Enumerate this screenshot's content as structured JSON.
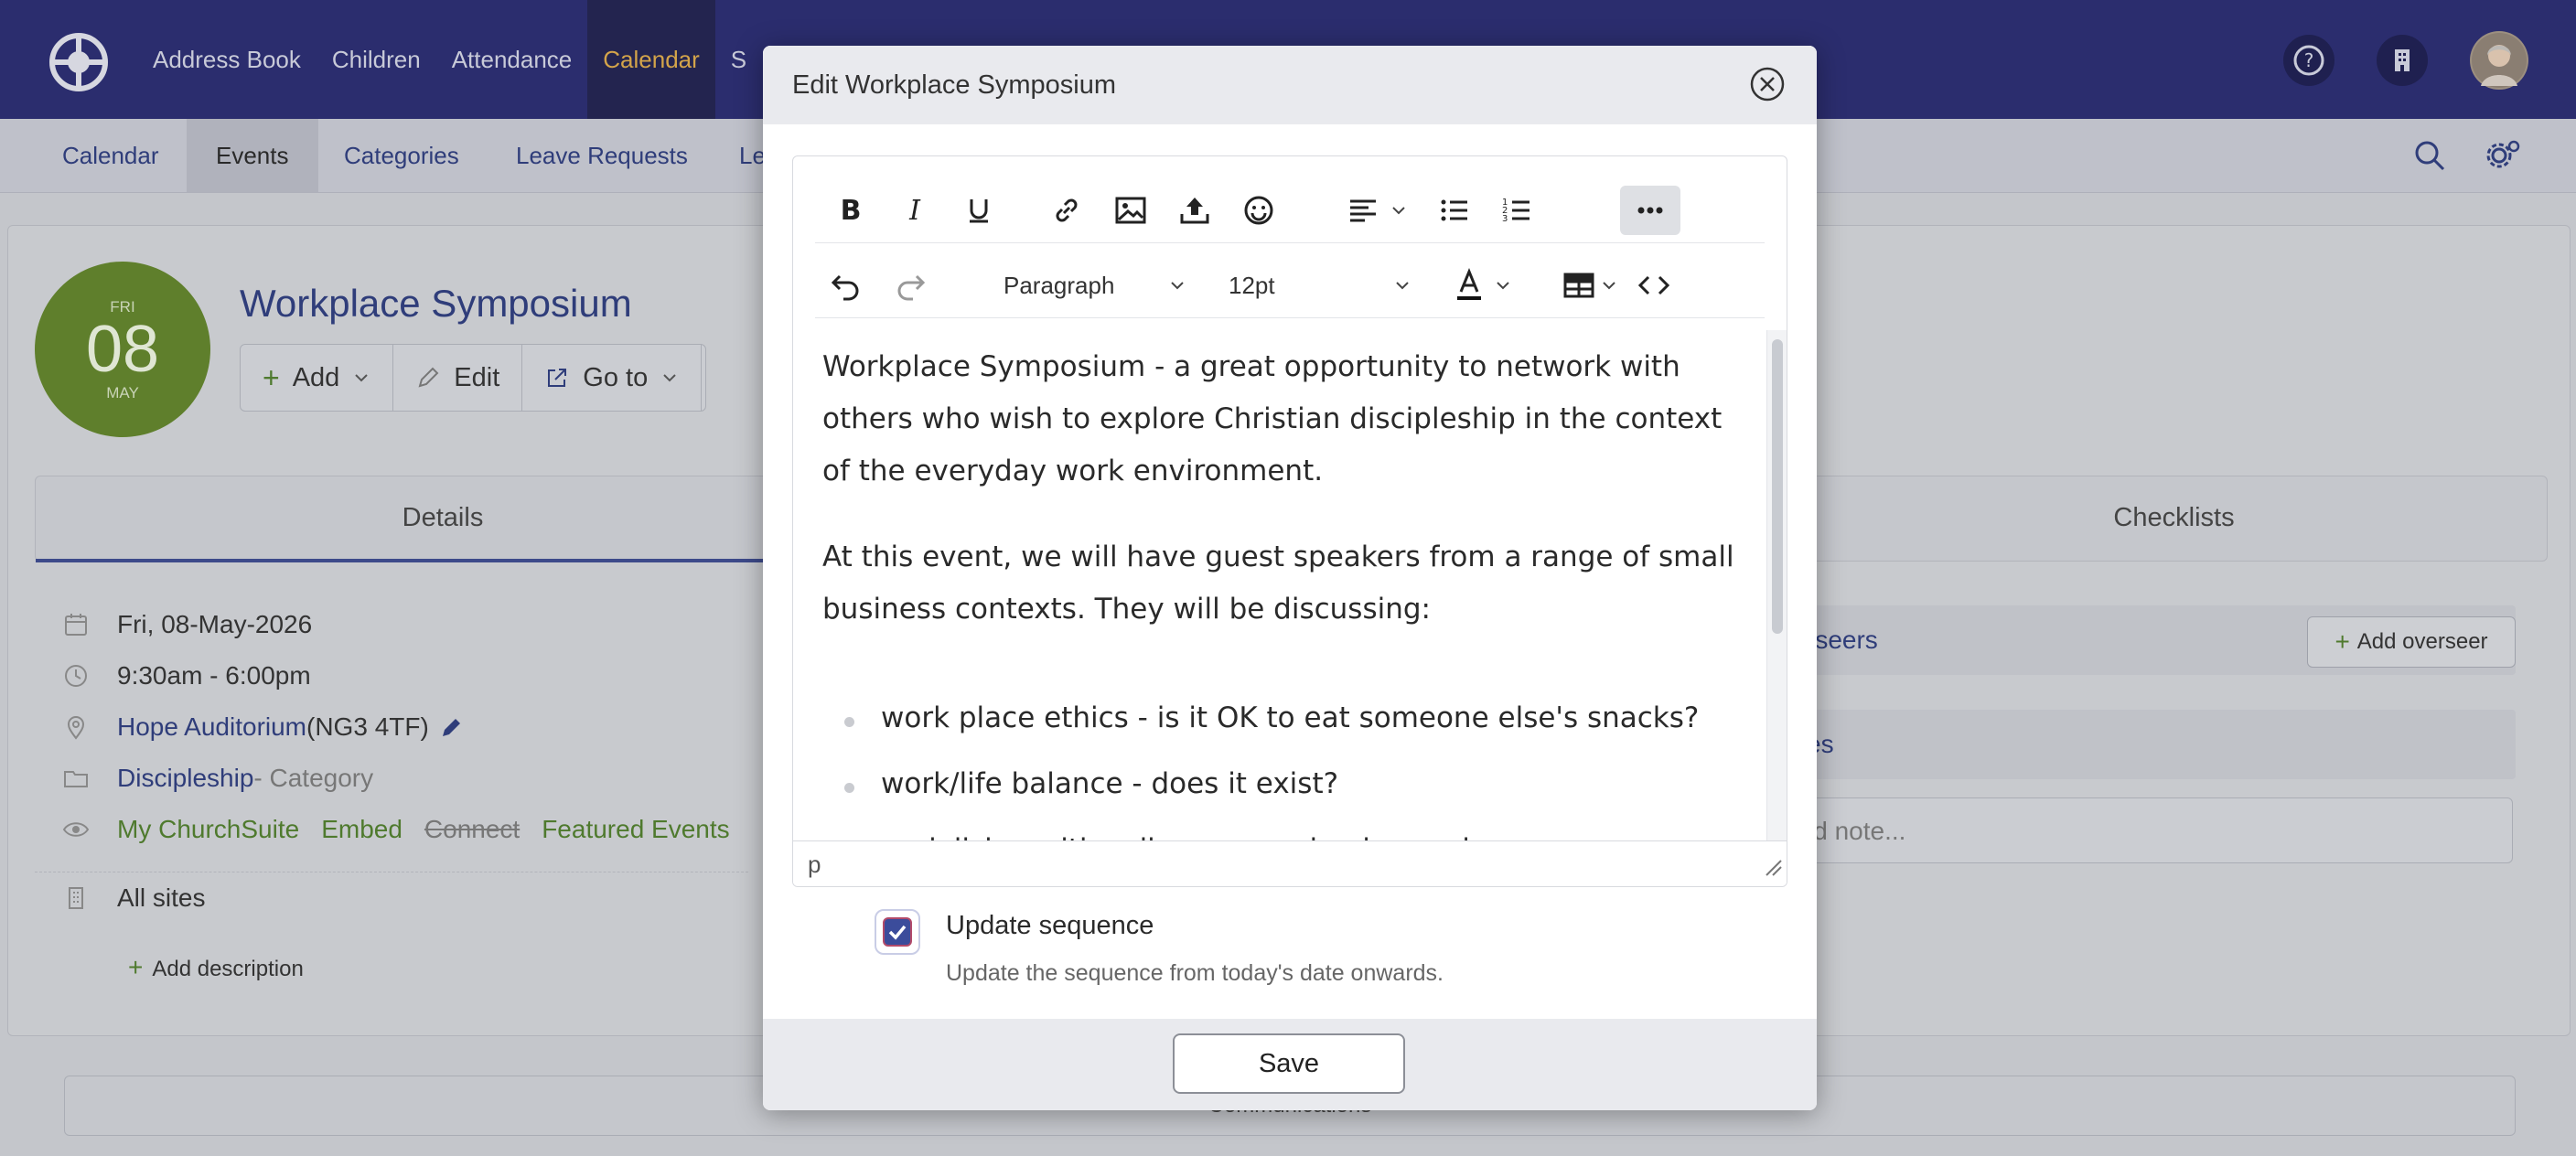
{
  "topnav": {
    "items": [
      "Address Book",
      "Children",
      "Attendance",
      "Calendar",
      "S"
    ],
    "active_index": 3
  },
  "subnav": {
    "items": [
      "Calendar",
      "Events",
      "Categories",
      "Leave Requests",
      "Le"
    ],
    "active_index": 1
  },
  "event": {
    "date": {
      "dow": "FRI",
      "day": "08",
      "month": "MAY"
    },
    "title": "Workplace Symposium",
    "buttons": {
      "add": "Add",
      "edit": "Edit",
      "goto": "Go to"
    },
    "tabs": {
      "details": "Details",
      "checklists": "Checklists"
    },
    "details": {
      "date": "Fri, 08-May-2026",
      "time": "9:30am - 6:00pm",
      "location_name": "Hope Auditorium",
      "location_postcode": " (NG3 4TF)",
      "category_name": "Discipleship",
      "category_suffix": " - Category",
      "visibility": [
        "My ChurchSuite",
        "Embed",
        "Connect",
        "Featured Events"
      ],
      "sites": "All sites"
    },
    "add_description": "Add description",
    "overseers_label": "rseers",
    "add_overseer": "Add overseer",
    "notes_label": "es",
    "note_placeholder": "ld note...",
    "communications": "Communications"
  },
  "modal": {
    "title": "Edit Workplace Symposium",
    "toolbar": {
      "block_format": "Paragraph",
      "font_size": "12pt"
    },
    "content": {
      "paragraphs": [
        "Workplace Symposium - a great opportunity to network with others who wish to explore Christian discipleship in the context of the everyday work environment.",
        "At this event, we will have guest speakers from a range of small business contexts. They will be discussing:"
      ],
      "bullets": [
        "work place ethics - is it OK to eat someone else's snacks?",
        "work/life balance - does it exist?",
        "socialising with colleagues - why, how, when"
      ]
    },
    "status_path": "p",
    "checkbox": {
      "checked": true,
      "label": "Update sequence",
      "help": "Update the sequence from today's date onwards."
    },
    "save_label": "Save"
  },
  "colors": {
    "topbar": "#2b2d6e",
    "accent_nav": "#d3a44a",
    "date_badge": "#5f7f2c",
    "link_green": "#4f7a2e",
    "checkbox_fill": "#3b4c9b"
  }
}
